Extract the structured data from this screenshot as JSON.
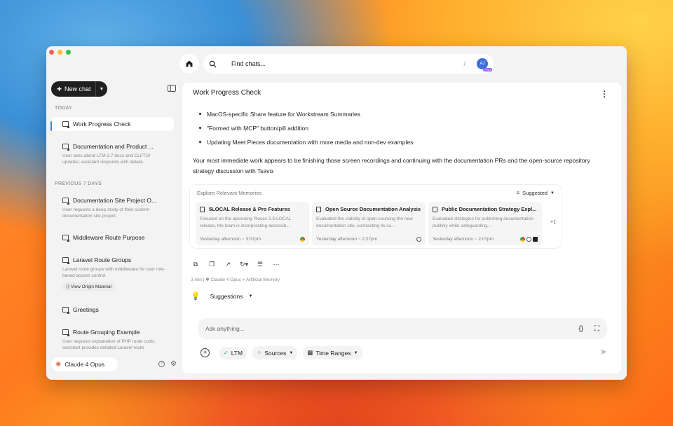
{
  "topbar": {
    "search_placeholder": "Find chats...",
    "search_shortcut": "/",
    "avatar_initials": "AJ",
    "avatar_badge": "PRO"
  },
  "sidebar": {
    "new_chat_label": "New chat",
    "today_label": "TODAY",
    "previous_label": "PREVIOUS 7 DAYS",
    "today_items": [
      {
        "title": "Work Progress Check",
        "desc": ""
      },
      {
        "title": "Documentation and Product ...",
        "desc": "User asks about LTM-2.7 docs and CLI/TUI updates; assistant responds with details."
      }
    ],
    "previous_items": [
      {
        "title": "Documentation Site Project O...",
        "desc": "User requests a deep study of their custom documentation site project."
      },
      {
        "title": "Middleware Route Purpose",
        "desc": ""
      },
      {
        "title": "Laravel Route Groups",
        "desc": "Laravel route groups with middleware for user role-based access control.",
        "chip": "View Origin Material"
      },
      {
        "title": "Greetings",
        "desc": ""
      },
      {
        "title": "Route Grouping Example",
        "desc": "User requests explanation of PHP route code; assistant provides detailed Laravel route"
      }
    ],
    "model_label": "Claude 4 Opus",
    "help_glyph": "?"
  },
  "main": {
    "title": "Work Progress Check",
    "bullets": [
      "MacOS-specific Share feature for Workstream Summaries",
      "\"Formed with MCP\" button/pill addition",
      "Updating Meet Pieces documentation with more media and non-dev examples"
    ],
    "summary": "Your most immediate work appears to be finishing those screen recordings and continuing with the documentation PRs and the open-source repository strategy discussion with Tsavo.",
    "memories": {
      "label": "Explore Relevant Memories",
      "sort_label": "Suggested",
      "more": "+1",
      "cards": [
        {
          "title": "5LOCAL Release & Pro Features",
          "desc": "Focused on the upcoming Pieces 2.5-LOCAL release, the team is incorporating accessib...",
          "time": "Yesterday afternoon ~ 3:07pm"
        },
        {
          "title": "Open Source Documentation Analysis",
          "desc": "Evaluated the viability of open-sourcing the new documentation site, contrasting its cu...",
          "time": "Yesterday afternoon ~ 2:27pm"
        },
        {
          "title": "Public Documentation Strategy Expl...",
          "desc": "Evaluated strategies for publishing documentation publicly while safeguarding...",
          "time": "Yesterday afternoon ~ 2:07pm"
        }
      ]
    },
    "meta": "3 min | ✱ Claude 4 Opus + Artificial Memory",
    "suggestions_label": "Suggestions",
    "ask_placeholder": "Ask anything...",
    "ask_icon_code": "{}",
    "chips": {
      "ltm": "LTM",
      "sources": "Sources",
      "time_ranges": "Time Ranges"
    }
  }
}
